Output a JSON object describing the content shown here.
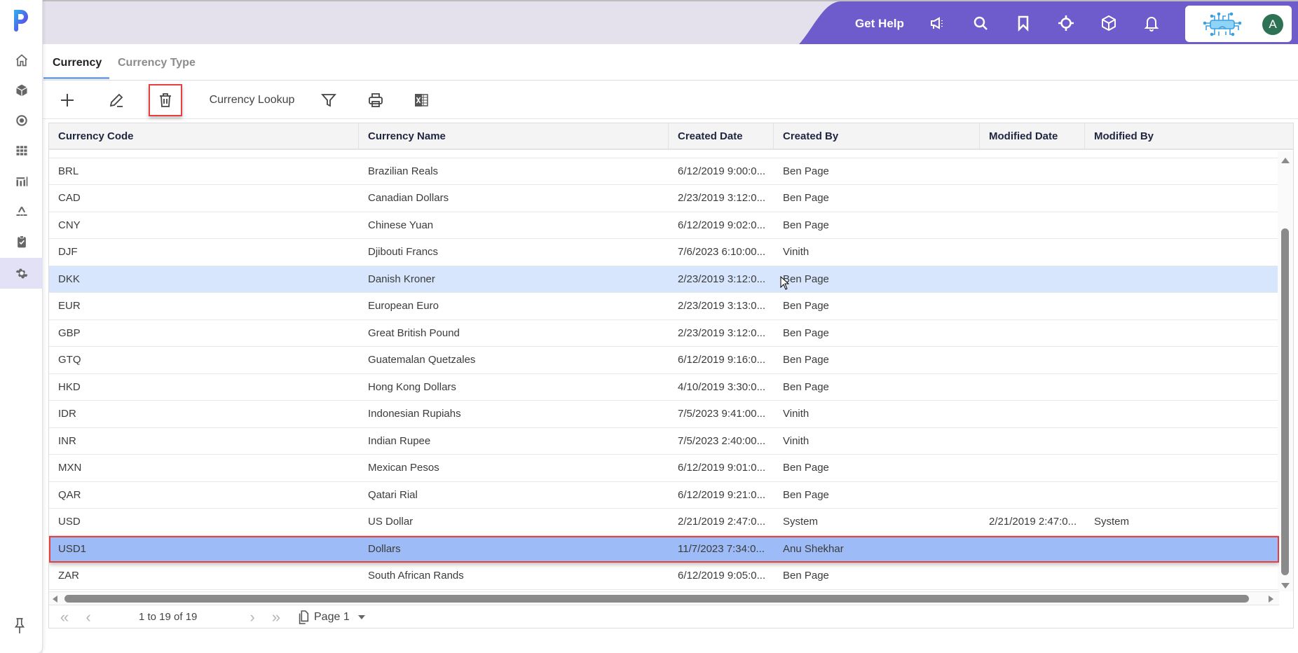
{
  "sidebar": {
    "logo": "P",
    "items": [
      {
        "name": "home",
        "icon": "home-icon"
      },
      {
        "name": "products",
        "icon": "cube-icon"
      },
      {
        "name": "target",
        "icon": "target-icon"
      },
      {
        "name": "grid",
        "icon": "grid-icon"
      },
      {
        "name": "reports",
        "icon": "chart-icon"
      },
      {
        "name": "hierarchy",
        "icon": "hierarchy-icon"
      },
      {
        "name": "tasks",
        "icon": "clipboard-check-icon"
      },
      {
        "name": "settings",
        "icon": "gear-icon",
        "active": true
      }
    ],
    "pin_icon": "pin-icon"
  },
  "topbar": {
    "get_help": "Get Help",
    "icons": [
      "megaphone-icon",
      "search-icon",
      "bookmark-icon",
      "crosshair-icon",
      "box-icon",
      "bell-icon"
    ],
    "avatar_initial": "A",
    "accent": "#6f5ccc",
    "avatar_color": "#2e7256"
  },
  "tabs": [
    {
      "label": "Currency",
      "active": true
    },
    {
      "label": "Currency Type",
      "active": false
    }
  ],
  "toolbar": {
    "add": "plus-icon",
    "edit": "pencil-icon",
    "delete": "trash-icon",
    "lookup_label": "Currency Lookup",
    "filter": "filter-icon",
    "print": "printer-icon",
    "excel": "excel-icon"
  },
  "grid": {
    "columns": [
      "Currency Code",
      "Currency Name",
      "Created Date",
      "Created By",
      "Modified Date",
      "Modified By"
    ],
    "rows": [
      {
        "code": "BRL",
        "name": "Brazilian Reals",
        "created": "6/12/2019 9:00:0...",
        "by": "Ben Page",
        "modified": "",
        "mod_by": ""
      },
      {
        "code": "CAD",
        "name": "Canadian Dollars",
        "created": "2/23/2019 3:12:0...",
        "by": "Ben Page",
        "modified": "",
        "mod_by": ""
      },
      {
        "code": "CNY",
        "name": "Chinese Yuan",
        "created": "6/12/2019 9:02:0...",
        "by": "Ben Page",
        "modified": "",
        "mod_by": ""
      },
      {
        "code": "DJF",
        "name": "Djibouti Francs",
        "created": "7/6/2023 6:10:00...",
        "by": "Vinith",
        "modified": "",
        "mod_by": ""
      },
      {
        "code": "DKK",
        "name": "Danish Kroner",
        "created": "2/23/2019 3:12:0...",
        "by": "Ben Page",
        "modified": "",
        "mod_by": "",
        "state": "hover"
      },
      {
        "code": "EUR",
        "name": "European Euro",
        "created": "2/23/2019 3:13:0...",
        "by": "Ben Page",
        "modified": "",
        "mod_by": ""
      },
      {
        "code": "GBP",
        "name": "Great British Pound",
        "created": "2/23/2019 3:12:0...",
        "by": "Ben Page",
        "modified": "",
        "mod_by": ""
      },
      {
        "code": "GTQ",
        "name": "Guatemalan Quetzales",
        "created": "6/12/2019 9:16:0...",
        "by": "Ben Page",
        "modified": "",
        "mod_by": ""
      },
      {
        "code": "HKD",
        "name": "Hong Kong Dollars",
        "created": "4/10/2019 3:30:0...",
        "by": "Ben Page",
        "modified": "",
        "mod_by": ""
      },
      {
        "code": "IDR",
        "name": "Indonesian Rupiahs",
        "created": "7/5/2023 9:41:00...",
        "by": "Vinith",
        "modified": "",
        "mod_by": ""
      },
      {
        "code": "INR",
        "name": "Indian Rupee",
        "created": "7/5/2023 2:40:00...",
        "by": "Vinith",
        "modified": "",
        "mod_by": ""
      },
      {
        "code": "MXN",
        "name": "Mexican Pesos",
        "created": "6/12/2019 9:01:0...",
        "by": "Ben Page",
        "modified": "",
        "mod_by": ""
      },
      {
        "code": "QAR",
        "name": "Qatari Rial",
        "created": "6/12/2019 9:21:0...",
        "by": "Ben Page",
        "modified": "",
        "mod_by": ""
      },
      {
        "code": "USD",
        "name": "US Dollar",
        "created": "2/21/2019 2:47:0...",
        "by": "System",
        "modified": "2/21/2019 2:47:0...",
        "mod_by": "System"
      },
      {
        "code": "USD1",
        "name": "Dollars",
        "created": "11/7/2023 7:34:0...",
        "by": "Anu Shekhar",
        "modified": "",
        "mod_by": "",
        "state": "selected"
      },
      {
        "code": "ZAR",
        "name": "South African Rands",
        "created": "6/12/2019 9:05:0...",
        "by": "Ben Page",
        "modified": "",
        "mod_by": ""
      }
    ]
  },
  "pager": {
    "summary": "1 to 19 of 19",
    "page_label": "Page 1"
  }
}
